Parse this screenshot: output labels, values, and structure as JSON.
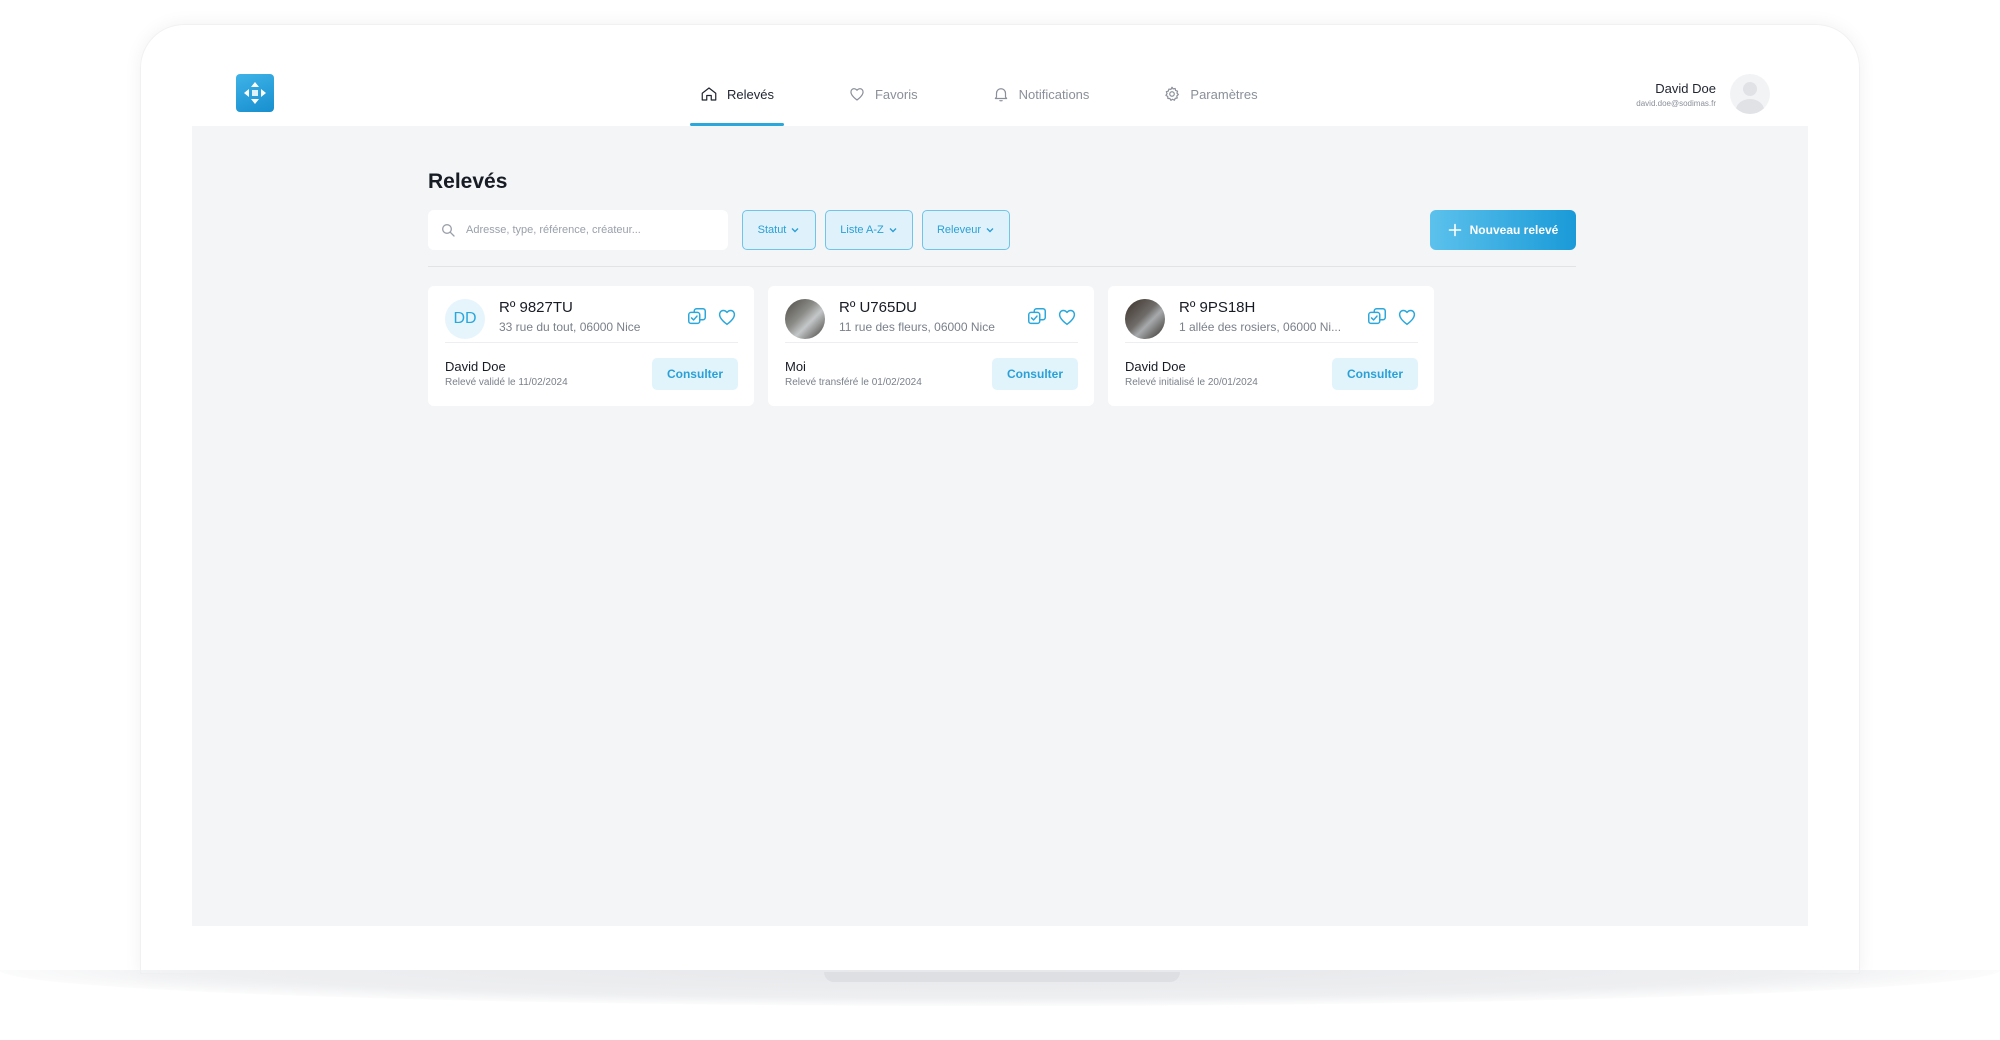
{
  "user": {
    "name": "David Doe",
    "email": "david.doe@sodimas.fr"
  },
  "nav": [
    {
      "label": "Relevés",
      "icon": "home-icon"
    },
    {
      "label": "Favoris",
      "icon": "heart-icon"
    },
    {
      "label": "Notifications",
      "icon": "bell-icon"
    },
    {
      "label": "Paramètres",
      "icon": "gear-icon"
    }
  ],
  "page": {
    "title": "Relevés"
  },
  "search": {
    "placeholder": "Adresse, type, référence, créateur..."
  },
  "filters": {
    "statut": "Statut",
    "liste": "Liste A-Z",
    "releveur": "Releveur"
  },
  "new_button": "Nouveau relevé",
  "cards": [
    {
      "initials": "DD",
      "reference": "Rº 9827TU",
      "address": "33 rue du tout, 06000 Nice",
      "owner": "David Doe",
      "status": "Relevé validé le 11/02/2024",
      "action": "Consulter"
    },
    {
      "reference": "Rº U765DU",
      "address": "11 rue des fleurs, 06000 Nice",
      "owner": "Moi",
      "status": "Relevé transféré le 01/02/2024",
      "action": "Consulter"
    },
    {
      "reference": "Rº 9PS18H",
      "address": "1 allée des rosiers, 06000 Ni...",
      "owner": "David Doe",
      "status": "Relevé initialisé le 20/01/2024",
      "action": "Consulter"
    }
  ],
  "colors": {
    "accent": "#2aa7db",
    "background": "#f4f5f7",
    "card": "#ffffff"
  }
}
